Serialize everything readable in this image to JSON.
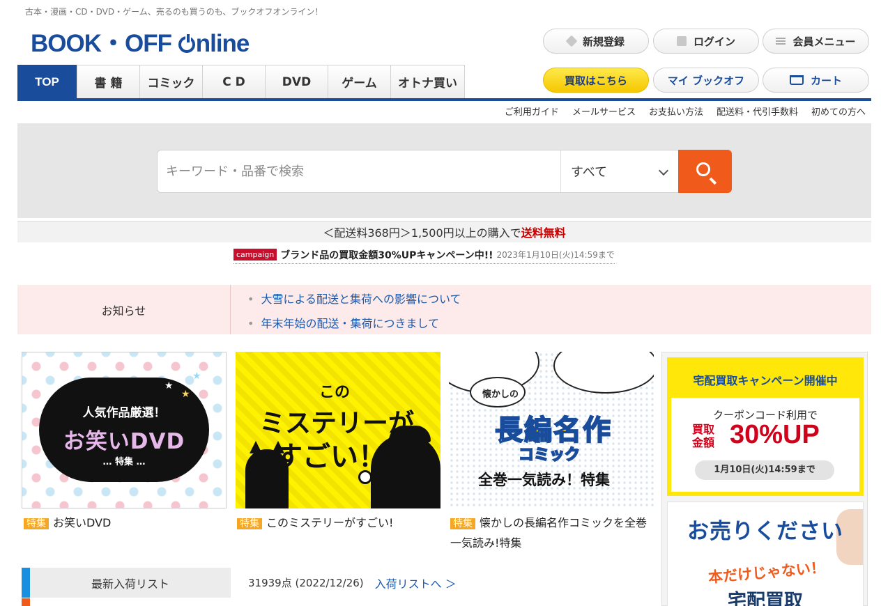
{
  "header": {
    "tagline": "古本・漫画・CD・DVD・ゲーム、売るのも買うのも、ブックオフオンライン！",
    "logo_alt": "BOOK・OFF Online",
    "register": "新規登録",
    "login": "ログイン",
    "member_menu": "会員メニュー",
    "buyback": "買取はこちら",
    "my_bookoff": "マイ ブックオフ",
    "cart": "カート"
  },
  "nav": {
    "tabs": [
      "TOP",
      "書 籍",
      "コミック",
      "C D",
      "DVD",
      "ゲーム",
      "オトナ買い"
    ]
  },
  "sublinks": [
    "ご利用ガイド",
    "メールサービス",
    "お支払い方法",
    "配送料・代引手数料",
    "初めての方へ"
  ],
  "search": {
    "placeholder": "キーワード・品番で検索",
    "category": "すべて"
  },
  "shipping": {
    "prefix": "＜配送料368円＞1,500円以上の購入で",
    "highlight": "送料無料"
  },
  "campaign": {
    "tag": "campaign",
    "title": "ブランド品の買取金額30%UPキャンペーン中!!",
    "date": "2023年1月10日(火)14:59まで"
  },
  "news": {
    "label": "お知らせ",
    "items": [
      "大雪による配送と集荷への影響について",
      "年末年始の配送・集荷につきまして"
    ]
  },
  "features": [
    {
      "badge": "特集",
      "caption": "お笑いDVD",
      "banner": {
        "line1": "人気作品厳選！",
        "line2": "お笑いDVD",
        "line3": "… 特集 …"
      }
    },
    {
      "badge": "特集",
      "caption": "このミステリーがすごい!",
      "banner": {
        "line1": "この",
        "line2": "ミステリーが",
        "line3": "すごい！"
      }
    },
    {
      "badge": "特集",
      "caption": "懐かしの長編名作コミックを全巻一気読み!特集",
      "banner": {
        "line1": "懐かしの",
        "line2": "長編名作",
        "line3": "コミック",
        "line4": "全巻一気読み！特集"
      }
    }
  ],
  "arrivals": {
    "label": "最新入荷リスト",
    "count": "31939点 (2022/12/26)",
    "link": "入荷リストへ ＞"
  },
  "sidebar": {
    "banner1": {
      "title": "宅配買取キャンペーン開催中",
      "line1": "クーポンコード利用で",
      "line2": "買取金額",
      "line3": "30%UP",
      "line4": "1月10日(火)14:59まで"
    },
    "banner2": {
      "line1": "お売りください",
      "line2": "本だけじゃない！",
      "line3": "宅配買取"
    }
  }
}
